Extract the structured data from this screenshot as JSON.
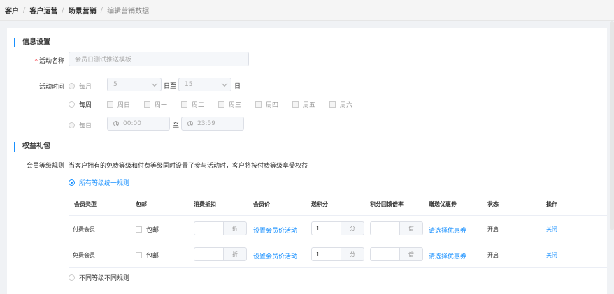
{
  "breadcrumb": [
    "客户",
    "客户运营",
    "场景营销",
    "编辑营销数据"
  ],
  "sections": {
    "info": "信息设置",
    "benefits": "权益礼包"
  },
  "form": {
    "activity_name_label": "活动名称",
    "activity_name_value": "会员日测试推送模板",
    "activity_time_label": "活动时间",
    "monthly_label": "每月",
    "monthly_start": "5",
    "day_to": "日至",
    "monthly_end": "15",
    "day": "日",
    "weekly_label": "每周",
    "weekdays": [
      "周日",
      "周一",
      "周二",
      "周三",
      "周四",
      "周五",
      "周六"
    ],
    "daily_label": "每日",
    "time_start": "00:00",
    "to": "至",
    "time_end": "23:59"
  },
  "member": {
    "rule_label": "会员等级规则",
    "rule_desc": "当客户拥有的免费等级和付费等级同时设置了参与活动时，客户将按付费等级享受权益",
    "option_unified": "所有等级统一规则",
    "option_different": "不同等级不同规则"
  },
  "table": {
    "headers": [
      "会员类型",
      "包邮",
      "消费折扣",
      "会员价",
      "送积分",
      "积分回馈倍率",
      "赠送优惠券",
      "状态",
      "操作"
    ],
    "rows": [
      {
        "type": "付费会员",
        "shipping": "包邮",
        "discount": "",
        "discount_unit": "折",
        "price": "设置会员价活动",
        "points": "1",
        "points_unit": "分",
        "rate": "",
        "rate_unit": "倍",
        "coupon": "请选择优惠券",
        "status": "开启",
        "action": "关闭"
      },
      {
        "type": "免费会员",
        "shipping": "包邮",
        "discount": "",
        "discount_unit": "折",
        "price": "设置会员价活动",
        "points": "1",
        "points_unit": "分",
        "rate": "",
        "rate_unit": "倍",
        "coupon": "请选择优惠券",
        "status": "开启",
        "action": "关闭"
      }
    ]
  }
}
